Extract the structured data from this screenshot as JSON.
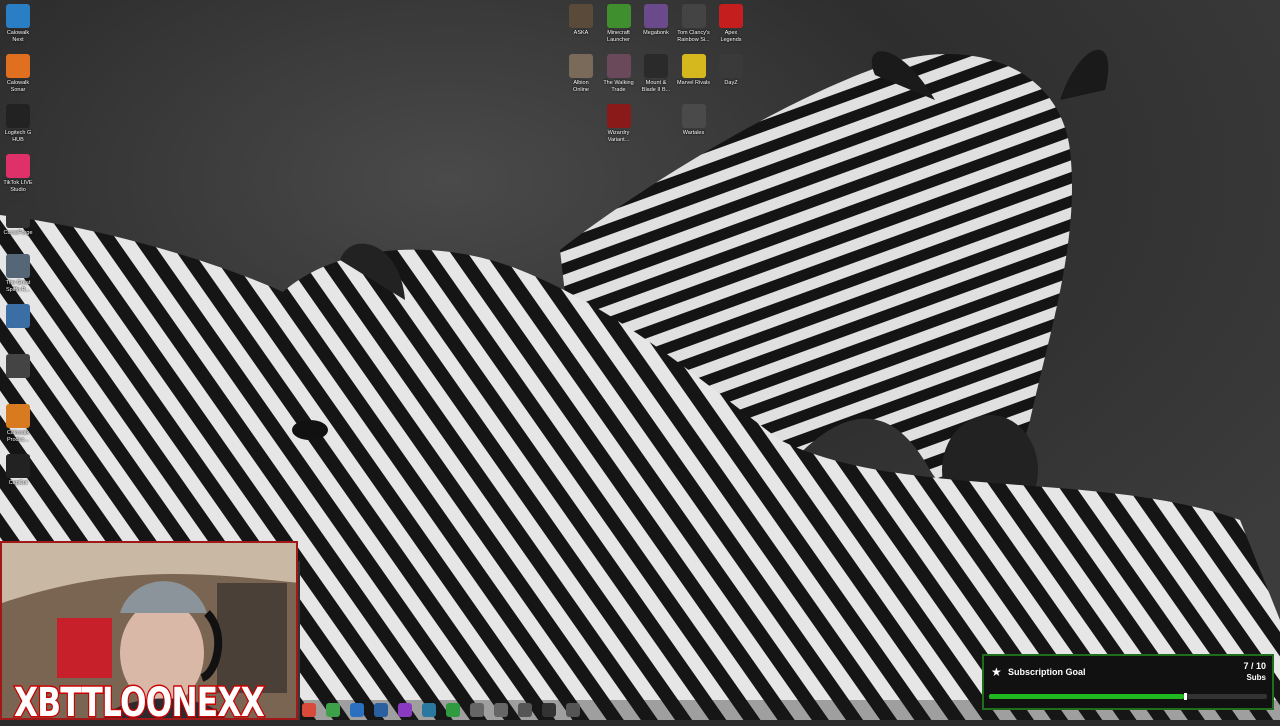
{
  "desktop": {
    "left_icons": [
      {
        "label": "Calowalk\nNext",
        "icon": "app-icon",
        "color": "#2a7fc4"
      },
      {
        "label": "Calowalk\nSonar",
        "icon": "app-icon",
        "color": "#e07020"
      },
      {
        "label": "Logitech G\nHUB",
        "icon": "logitech-icon",
        "color": "#222222"
      },
      {
        "label": "TikTok LIVE\nStudio",
        "icon": "tiktok-icon",
        "color": "#e0306a"
      },
      {
        "label": "CurseForge",
        "icon": "curseforge-icon",
        "color": "#333333"
      },
      {
        "label": "The Great\nSpiffo R...",
        "icon": "game-icon",
        "color": "#556677"
      },
      {
        "label": "",
        "icon": "shortcut-icon",
        "color": "#3a6ea5"
      },
      {
        "label": "",
        "icon": "app-icon",
        "color": "#444444"
      },
      {
        "label": "Calowalk\nProduc...",
        "icon": "app-icon",
        "color": "#d87a20"
      },
      {
        "label": "CapCut",
        "icon": "capcut-icon",
        "color": "#222222"
      }
    ],
    "game_icons": [
      {
        "label": "ASKA",
        "icon": "aska-icon",
        "color": "#5a4a3a"
      },
      {
        "label": "Minecraft\nLauncher",
        "icon": "minecraft-icon",
        "color": "#3f8f2f"
      },
      {
        "label": "Megabonk",
        "icon": "megabonk-icon",
        "color": "#6a4a8a"
      },
      {
        "label": "Tom Clancy's\nRainbow Si...",
        "icon": "rainbow-six-icon",
        "color": "#444444"
      },
      {
        "label": "Apex\nLegends",
        "icon": "apex-icon",
        "color": "#c41e1e"
      },
      {
        "label": "Albion\nOnline",
        "icon": "albion-icon",
        "color": "#7a6a5a"
      },
      {
        "label": "The Walking\nTrade",
        "icon": "walking-trade-icon",
        "color": "#6a4a5a"
      },
      {
        "label": "Mount &\nBlade II B...",
        "icon": "bannerlord-icon",
        "color": "#2a2a2a"
      },
      {
        "label": "Marvel Rivals",
        "icon": "marvel-rivals-icon",
        "color": "#d4b81e"
      },
      {
        "label": "DayZ",
        "icon": "dayz-icon",
        "color": "#3a3a3a"
      },
      {
        "label": "Wizardry\nVariant...",
        "icon": "wizardry-icon",
        "color": "#8a1a1a"
      },
      {
        "label": "Wartales",
        "icon": "wartales-icon",
        "color": "#4a4a4a"
      }
    ]
  },
  "taskbar": {
    "buttons": [
      {
        "icon": "browser-icon",
        "color": "#d94a3a"
      },
      {
        "icon": "app-icon",
        "color": "#3fa04a"
      },
      {
        "icon": "app-icon",
        "color": "#2a6fc0"
      },
      {
        "icon": "app-icon",
        "color": "#2a5fa0"
      },
      {
        "icon": "app-icon",
        "color": "#8a3ac0"
      },
      {
        "icon": "steam-icon",
        "color": "#2a78a0"
      },
      {
        "icon": "xbox-icon",
        "color": "#2f9a3f"
      },
      {
        "icon": "app-icon",
        "color": "#666666"
      },
      {
        "icon": "app-icon",
        "color": "#666666"
      },
      {
        "icon": "app-icon",
        "color": "#555555"
      },
      {
        "icon": "app-icon",
        "color": "#333333"
      },
      {
        "icon": "gear-icon",
        "color": "#555555"
      }
    ]
  },
  "overlay": {
    "streamer_name": "XBTTLOONEXX",
    "sub_goal": {
      "title": "Subscription Goal",
      "count": "7 / 10",
      "unit": "Subs",
      "progress": 0.7,
      "fill_color": "#1fb81f",
      "border_color": "#1e6e1e"
    }
  }
}
